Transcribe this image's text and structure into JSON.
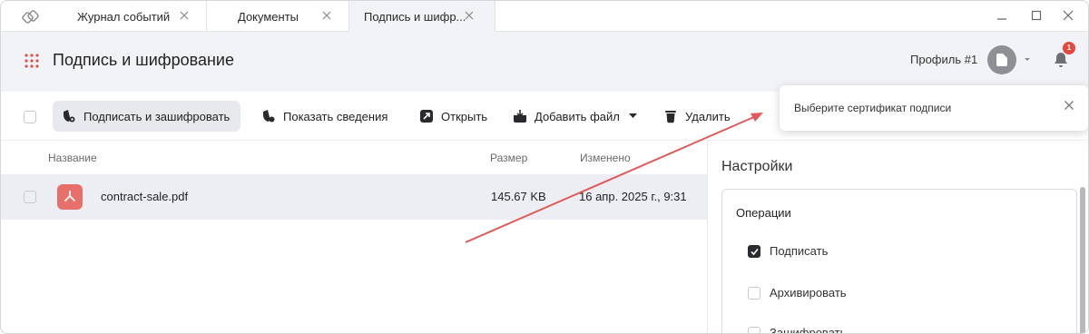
{
  "tabs": [
    {
      "label": "Журнал событий"
    },
    {
      "label": "Документы"
    },
    {
      "label": "Подпись и шифр..."
    }
  ],
  "header": {
    "title": "Подпись и шифрование",
    "profile_label": "Профиль #1",
    "notification_count": "1"
  },
  "toolbar": {
    "sign_encrypt": "Подписать и зашифровать",
    "show_details": "Показать сведения",
    "open": "Открыть",
    "add_file": "Добавить файл",
    "delete": "Удалить"
  },
  "table": {
    "columns": [
      "Название",
      "Размер",
      "Изменено"
    ],
    "rows": [
      {
        "name": "contract-sale.pdf",
        "size": "145.67 KB",
        "modified": "16 апр. 2025 г., 9:31"
      }
    ]
  },
  "settings": {
    "title": "Настройки",
    "operations_title": "Операции",
    "operations": [
      {
        "label": "Подписать",
        "checked": true
      },
      {
        "label": "Архивировать",
        "checked": false
      },
      {
        "label": "Зашифровать",
        "checked": false
      }
    ]
  },
  "toast": {
    "message": "Выберите сертификат подписи"
  },
  "colors": {
    "accent_arrow": "#e05a5a",
    "pdf_icon": "#e8706a",
    "badge": "#e5483d",
    "header_bg": "#f2f3f7"
  }
}
